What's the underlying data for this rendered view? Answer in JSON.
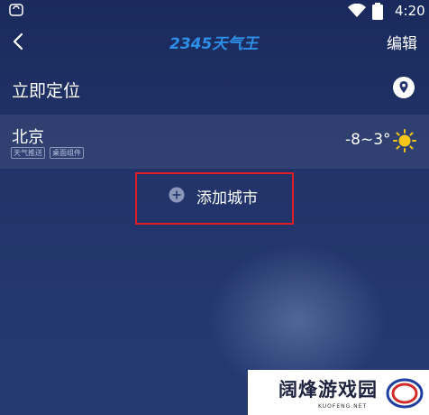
{
  "status_bar": {
    "time": "4:20"
  },
  "header": {
    "logo_text": "2345天气王",
    "edit_label": "编辑"
  },
  "locate": {
    "label": "立即定位"
  },
  "city": {
    "name": "北京",
    "tags": [
      "天气推送",
      "桌面组件"
    ],
    "temp_range": "-8~3°",
    "weather_icon": "sun-icon"
  },
  "add_city": {
    "label": "添加城市",
    "highlight_color": "#e01c27"
  },
  "watermark": {
    "title": "阔烽游戏园",
    "subtitle": "KUOFENG.NET"
  },
  "colors": {
    "background_top": "#1a2a5c",
    "background_bottom": "#263a72",
    "logo_blue": "#2d8fe8",
    "sun_yellow": "#f5c518"
  }
}
